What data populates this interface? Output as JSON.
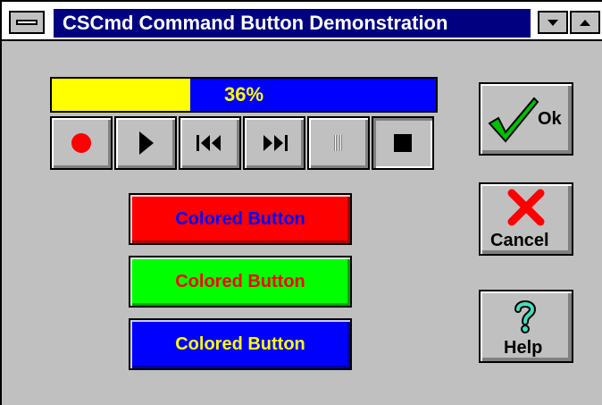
{
  "window": {
    "title": "CSCmd Command Button Demonstration",
    "minimize_icon": "down-triangle-icon",
    "maximize_icon": "up-triangle-icon"
  },
  "progress": {
    "label": "36%",
    "value": 0.36,
    "fill_color": "#ffff00",
    "track_color": "#0000ff",
    "text_color": "#ffff00"
  },
  "media_controls": [
    {
      "name": "record",
      "icon": "record-icon"
    },
    {
      "name": "play",
      "icon": "play-icon"
    },
    {
      "name": "skip-back",
      "icon": "skip-back-icon"
    },
    {
      "name": "skip-forward",
      "icon": "skip-forward-icon"
    },
    {
      "name": "pause",
      "icon": "pause-icon",
      "disabled": true
    },
    {
      "name": "stop",
      "icon": "stop-icon"
    }
  ],
  "colored_buttons": [
    {
      "label": "Colored Button",
      "background": "#ff0000",
      "text_color": "#0000ff"
    },
    {
      "label": "Colored Button",
      "background": "#00ff00",
      "text_color": "#ff0000"
    },
    {
      "label": "Colored Button",
      "background": "#0000ff",
      "text_color": "#ffff00"
    }
  ],
  "action_buttons": {
    "ok": {
      "label": "Ok",
      "icon": "checkmark-icon",
      "icon_color": "#00c000"
    },
    "cancel": {
      "label": "Cancel",
      "icon": "x-icon",
      "icon_color": "#ff0000"
    },
    "help": {
      "label": "Help",
      "icon": "question-mark-icon",
      "icon_color": "#40e0c0"
    }
  }
}
